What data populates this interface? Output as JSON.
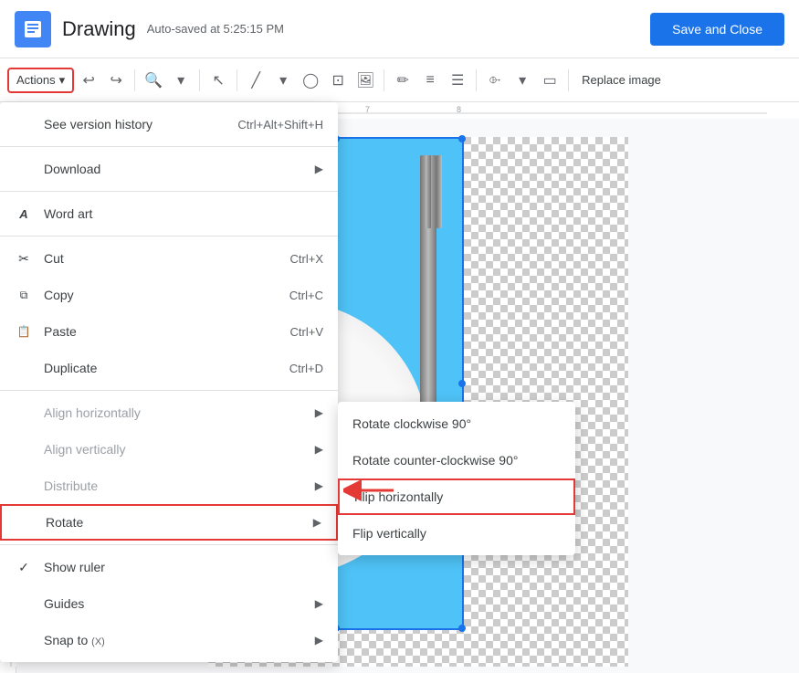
{
  "header": {
    "title": "Drawing",
    "autosave": "Auto-saved at 5:25:15 PM",
    "save_close": "Save and Close"
  },
  "toolbar": {
    "actions_label": "Actions",
    "actions_arrow": "▾",
    "replace_image": "Replace image"
  },
  "menu": {
    "items": [
      {
        "id": "version-history",
        "label": "See version history",
        "shortcut": "Ctrl+Alt+Shift+H",
        "icon": "",
        "has_arrow": false,
        "disabled": false,
        "underline_char": "S"
      },
      {
        "id": "download",
        "label": "Download",
        "shortcut": "",
        "icon": "",
        "has_arrow": true,
        "disabled": false
      },
      {
        "id": "word-art",
        "label": "Word art",
        "shortcut": "",
        "icon": "A",
        "has_arrow": false,
        "disabled": false
      },
      {
        "id": "cut",
        "label": "Cut",
        "shortcut": "Ctrl+X",
        "icon": "✂",
        "has_arrow": false,
        "disabled": false
      },
      {
        "id": "copy",
        "label": "Copy",
        "shortcut": "Ctrl+C",
        "icon": "⧉",
        "has_arrow": false,
        "disabled": false
      },
      {
        "id": "paste",
        "label": "Paste",
        "shortcut": "Ctrl+V",
        "icon": "⬜",
        "has_arrow": false,
        "disabled": false
      },
      {
        "id": "duplicate",
        "label": "Duplicate",
        "shortcut": "Ctrl+D",
        "icon": "",
        "has_arrow": false,
        "disabled": false
      },
      {
        "id": "align-h",
        "label": "Align horizontally",
        "shortcut": "",
        "icon": "",
        "has_arrow": true,
        "disabled": true
      },
      {
        "id": "align-v",
        "label": "Align vertically",
        "shortcut": "",
        "icon": "",
        "has_arrow": true,
        "disabled": true
      },
      {
        "id": "distribute",
        "label": "Distribute",
        "shortcut": "",
        "icon": "",
        "has_arrow": true,
        "disabled": true
      },
      {
        "id": "rotate",
        "label": "Rotate",
        "shortcut": "",
        "icon": "",
        "has_arrow": true,
        "disabled": false,
        "highlighted": true
      },
      {
        "id": "show-ruler",
        "label": "Show ruler",
        "shortcut": "",
        "icon": "✓",
        "has_arrow": false,
        "disabled": false
      },
      {
        "id": "guides",
        "label": "Guides",
        "shortcut": "",
        "icon": "",
        "has_arrow": true,
        "disabled": false
      },
      {
        "id": "snap-to",
        "label": "Snap to",
        "shortcut": "(X)",
        "icon": "",
        "has_arrow": true,
        "disabled": false
      }
    ]
  },
  "submenu": {
    "items": [
      {
        "id": "rotate-cw",
        "label": "Rotate clockwise 90°"
      },
      {
        "id": "rotate-ccw",
        "label": "Rotate counter-clockwise 90°"
      },
      {
        "id": "flip-h",
        "label": "Flip horizontally",
        "highlighted": true
      },
      {
        "id": "flip-v",
        "label": "Flip vertically"
      }
    ]
  }
}
